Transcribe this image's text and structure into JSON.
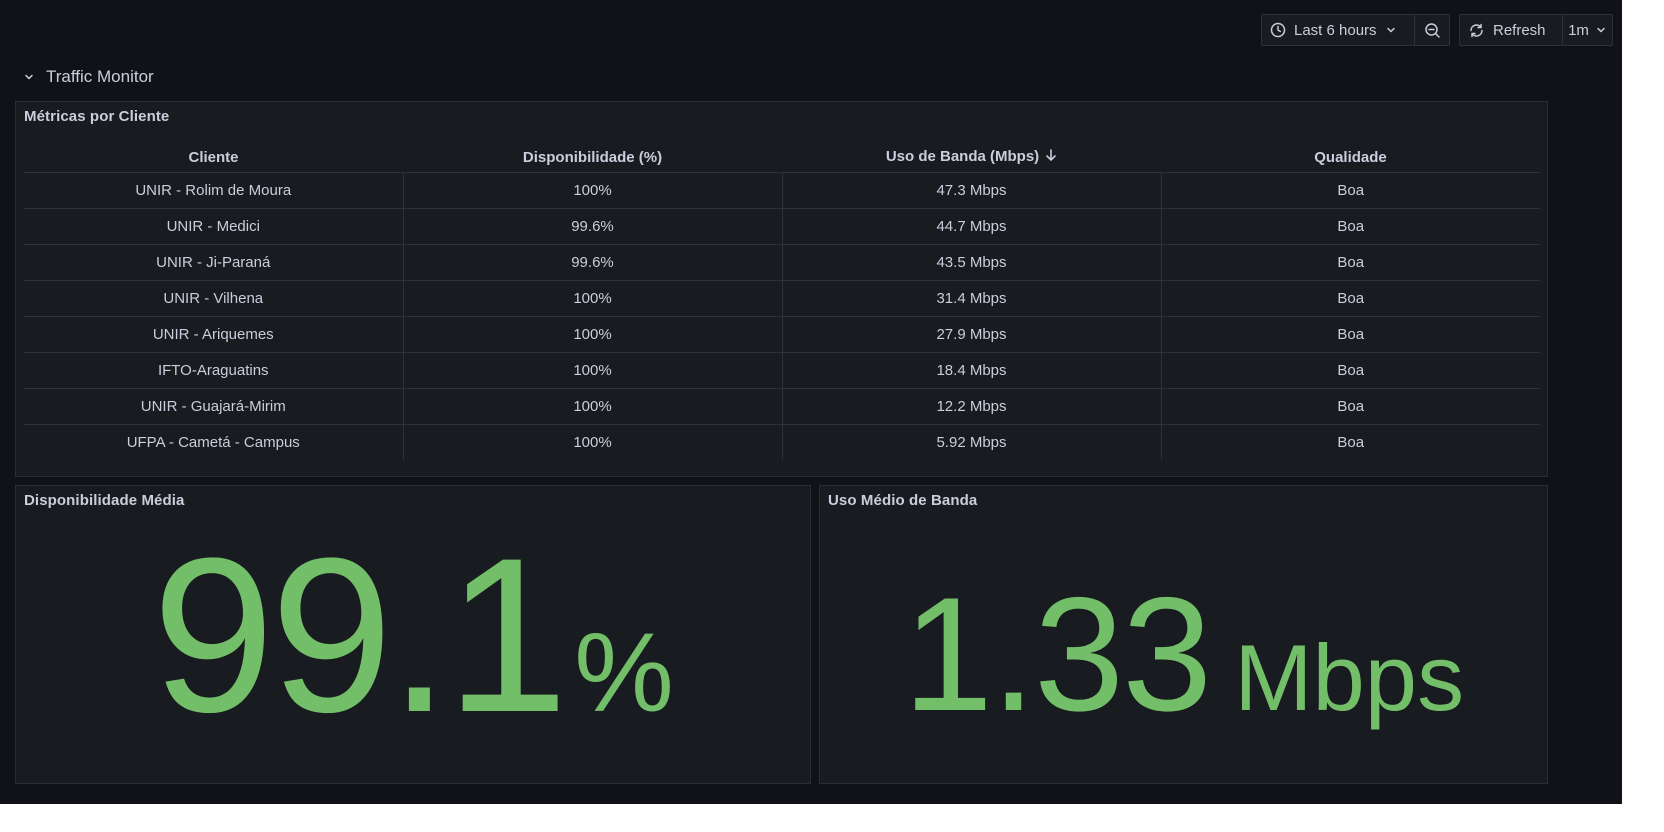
{
  "toolbar": {
    "time_range_label": "Last 6 hours",
    "refresh_label": "Refresh",
    "refresh_interval": "1m"
  },
  "row": {
    "title": "Traffic Monitor"
  },
  "table_panel": {
    "title": "Métricas por Cliente",
    "columns": [
      "Cliente",
      "Disponibilidade (%)",
      "Uso de Banda (Mbps)",
      "Qualidade"
    ],
    "sorted_column": "Uso de Banda (Mbps)",
    "sort_direction": "descending",
    "rows": [
      {
        "cliente": "UNIR - Rolim de Moura",
        "disponibilidade": "100%",
        "banda": "47.3 Mbps",
        "qualidade": "Boa"
      },
      {
        "cliente": "UNIR - Medici",
        "disponibilidade": "99.6%",
        "banda": "44.7 Mbps",
        "qualidade": "Boa"
      },
      {
        "cliente": "UNIR - Ji-Paraná",
        "disponibilidade": "99.6%",
        "banda": "43.5 Mbps",
        "qualidade": "Boa"
      },
      {
        "cliente": "UNIR - Vilhena",
        "disponibilidade": "100%",
        "banda": "31.4 Mbps",
        "qualidade": "Boa"
      },
      {
        "cliente": "UNIR - Ariquemes",
        "disponibilidade": "100%",
        "banda": "27.9 Mbps",
        "qualidade": "Boa"
      },
      {
        "cliente": "IFTO-Araguatins",
        "disponibilidade": "100%",
        "banda": "18.4 Mbps",
        "qualidade": "Boa"
      },
      {
        "cliente": "UNIR - Guajará-Mirim",
        "disponibilidade": "100%",
        "banda": "12.2 Mbps",
        "qualidade": "Boa"
      },
      {
        "cliente": "UFPA - Cametá - Campus",
        "disponibilidade": "100%",
        "banda": "5.92 Mbps",
        "qualidade": "Boa"
      }
    ]
  },
  "availability_panel": {
    "title": "Disponibilidade Média",
    "value": "99.1",
    "unit": "%"
  },
  "bandwidth_panel": {
    "title": "Uso Médio de Banda",
    "value": "1.33",
    "unit": "Mbps"
  },
  "colors": {
    "background": "#111217",
    "panel": "#181b1f",
    "good": "#73bf69",
    "text": "#ccccdc"
  },
  "icons": {
    "time_picker": "clock-icon",
    "zoom_out": "zoom-out-icon",
    "refresh": "refresh-icon",
    "dropdown": "chevron-down-icon",
    "row_toggle": "chevron-down-icon",
    "sort": "arrow-down-icon"
  }
}
